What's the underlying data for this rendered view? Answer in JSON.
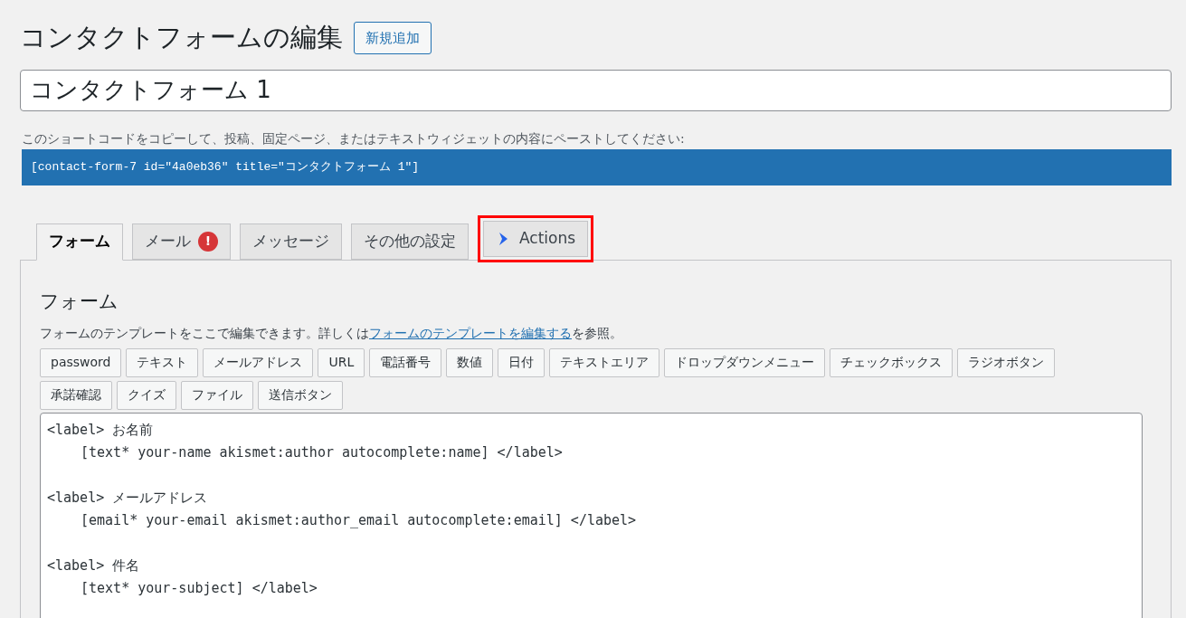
{
  "page_title": "コンタクトフォームの編集",
  "add_new_button": "新規追加",
  "form_title": {
    "value": "コンタクトフォーム 1"
  },
  "shortcode_hint": "このショートコードをコピーして、投稿、固定ページ、またはテキストウィジェットの内容にペーストしてください:",
  "shortcode": "[contact-form-7 id=\"4a0eb36\" title=\"コンタクトフォーム 1\"]",
  "tabs": [
    {
      "label": "フォーム",
      "selected": true,
      "kind": "plain",
      "highlighted": false
    },
    {
      "label": "メール",
      "selected": false,
      "kind": "alert",
      "badge": "!",
      "highlighted": false
    },
    {
      "label": "メッセージ",
      "selected": false,
      "kind": "plain",
      "highlighted": false
    },
    {
      "label": "その他の設定",
      "selected": false,
      "kind": "plain",
      "highlighted": false
    },
    {
      "label": "Actions",
      "selected": false,
      "kind": "icon",
      "highlighted": true
    }
  ],
  "panel": {
    "heading": "フォーム",
    "description": {
      "before": "フォームのテンプレートをここで編集できます。詳しくは",
      "link": "フォームのテンプレートを編集する",
      "after": "を参照。"
    },
    "tag_buttons": [
      [
        "password",
        "テキスト",
        "メールアドレス",
        "URL",
        "電話番号",
        "数値",
        "日付",
        "テキストエリア",
        "ドロップダウンメニュー",
        "チェックボックス",
        "ラジオボタン"
      ],
      [
        "承諾確認",
        "クイズ",
        "ファイル",
        "送信ボタン"
      ]
    ],
    "template": [
      {
        "label_line": "<label> お名前",
        "field_line": "[text* your-name akismet:author autocomplete:name] </label>"
      },
      {
        "label_line": "<label> メールアドレス",
        "field_line": "[email* your-email akismet:author_email autocomplete:email] </label>"
      },
      {
        "label_line": "<label> 件名",
        "field_line": "[text* your-subject] </label>"
      }
    ]
  }
}
